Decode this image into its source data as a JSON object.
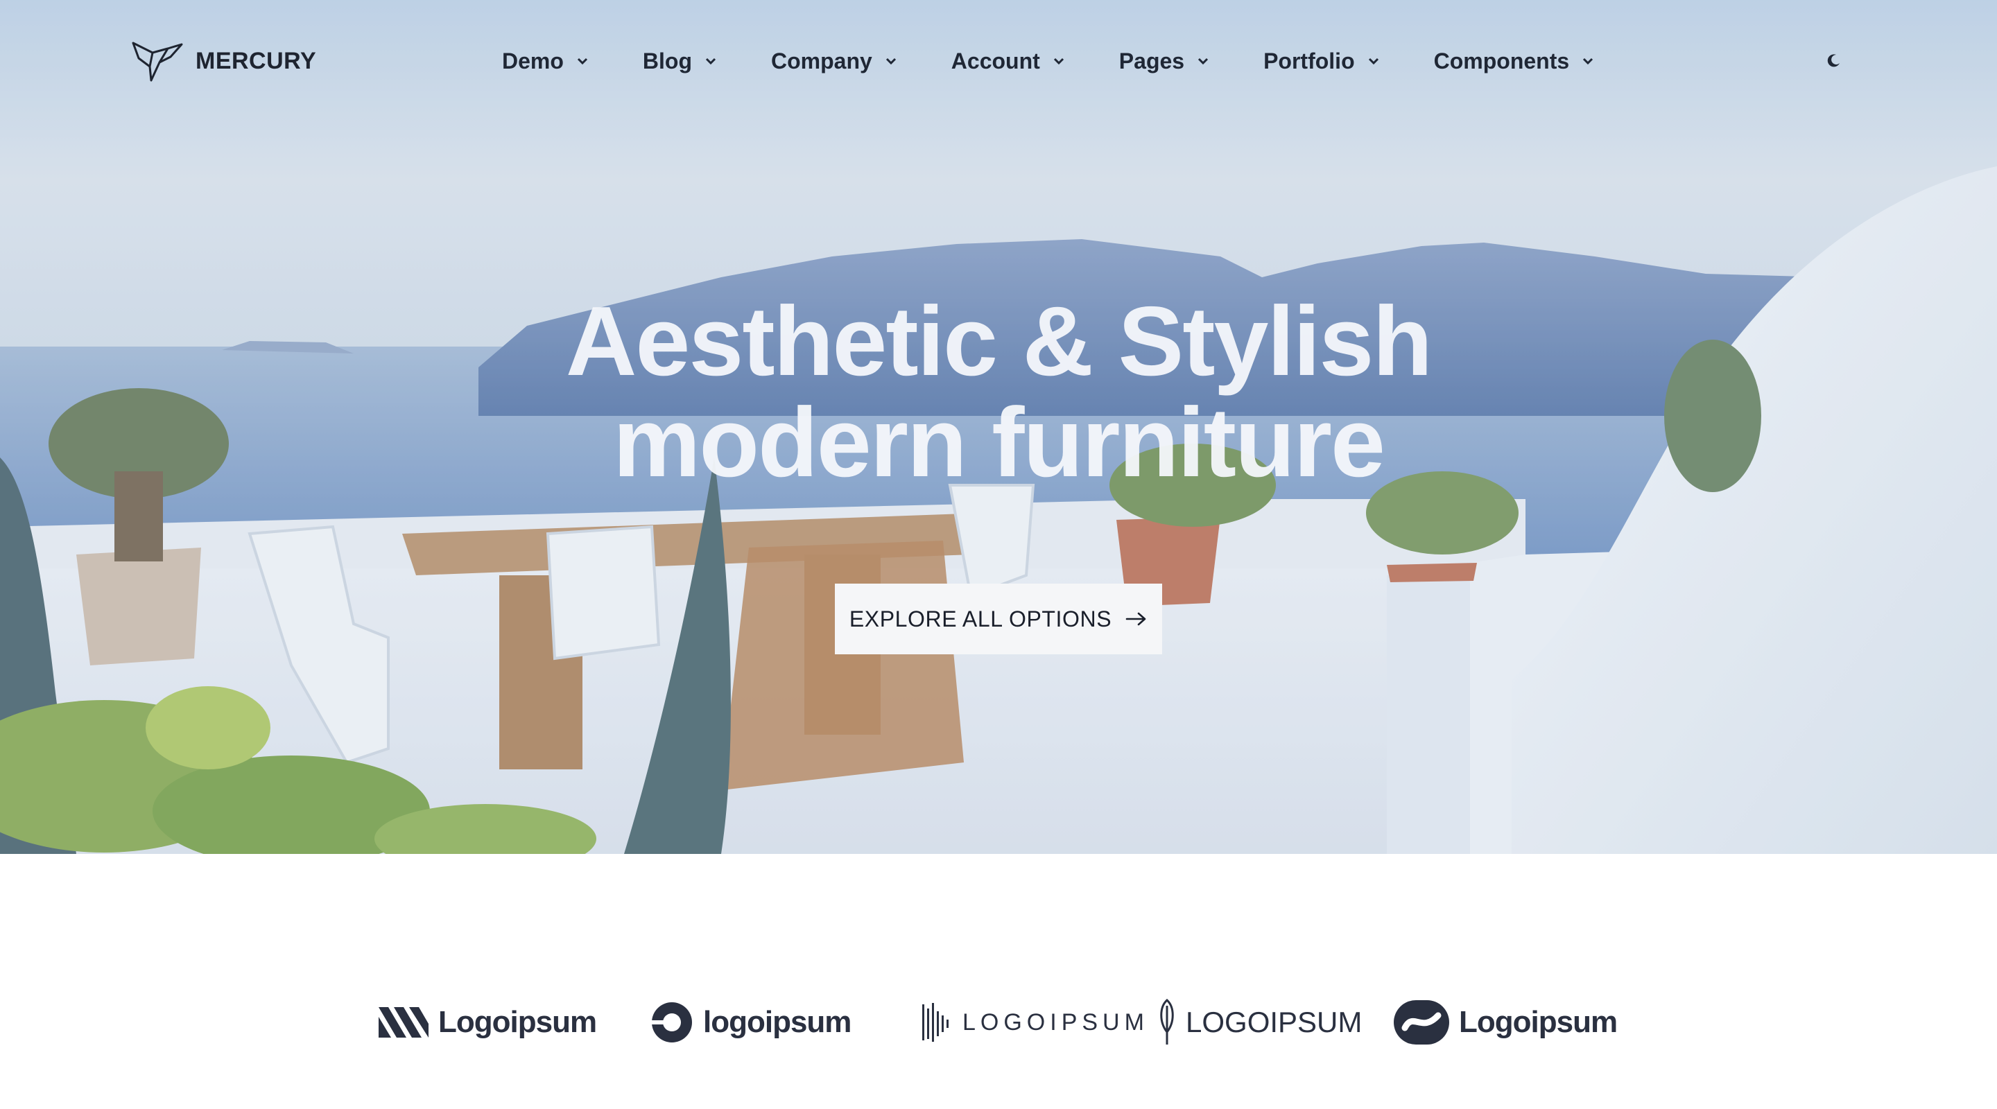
{
  "brand": {
    "name": "MERCURY",
    "icon": "bird-logo-icon"
  },
  "nav": {
    "items": [
      {
        "label": "Demo"
      },
      {
        "label": "Blog"
      },
      {
        "label": "Company"
      },
      {
        "label": "Account"
      },
      {
        "label": "Pages"
      },
      {
        "label": "Portfolio"
      },
      {
        "label": "Components"
      }
    ],
    "theme_toggle_icon": "moon-icon"
  },
  "hero": {
    "title_line1": "Aesthetic & Stylish",
    "title_line2": "modern furniture",
    "cta_label": "EXPLORE ALL OPTIONS",
    "cta_icon": "arrow-right-icon"
  },
  "partners": {
    "logos": [
      {
        "text": "Logoipsum"
      },
      {
        "text": "logoipsum"
      },
      {
        "text": "LOGOIPSUM"
      },
      {
        "text": "LOGOIPSUM"
      },
      {
        "text": "Logoipsum"
      }
    ]
  },
  "colors": {
    "text_dark": "#1f2735",
    "cta_bg": "#f5f6f8",
    "headline": "#f4f7fb",
    "logo": "#2a3040"
  }
}
